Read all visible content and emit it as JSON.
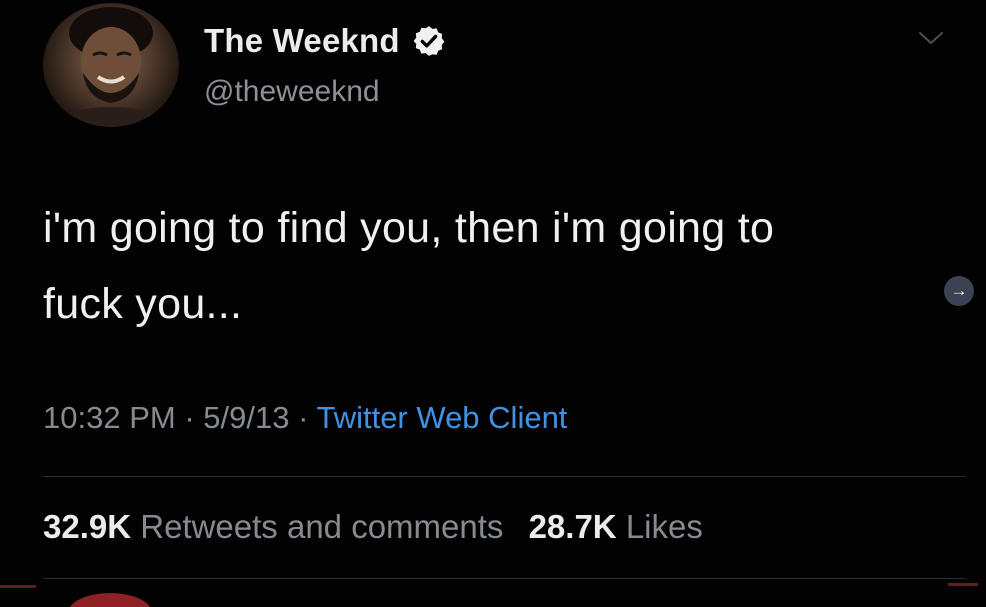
{
  "author": {
    "display_name": "The Weeknd",
    "handle": "@theweeknd",
    "verified": true,
    "avatar_icon": "profile-photo"
  },
  "tweet": {
    "text_line1": "i'm going to find you, then i'm going to",
    "text_line2": "fuck you..."
  },
  "meta": {
    "time": "10:32 PM",
    "separator": " · ",
    "date": "5/9/13",
    "client": "Twitter Web Client"
  },
  "stats": {
    "retweets_count": "32.9K",
    "retweets_label": "Retweets and comments",
    "likes_count": "28.7K",
    "likes_label": "Likes"
  },
  "icons": {
    "verified": "verified-badge-icon",
    "menu": "chevron-down-icon",
    "side": "arrow-right-icon"
  },
  "colors": {
    "background": "#020202",
    "link": "#3f92e6",
    "muted": "#868b91",
    "primary_text": "#f0f0f0",
    "verified_badge": "#f0f0f0"
  }
}
